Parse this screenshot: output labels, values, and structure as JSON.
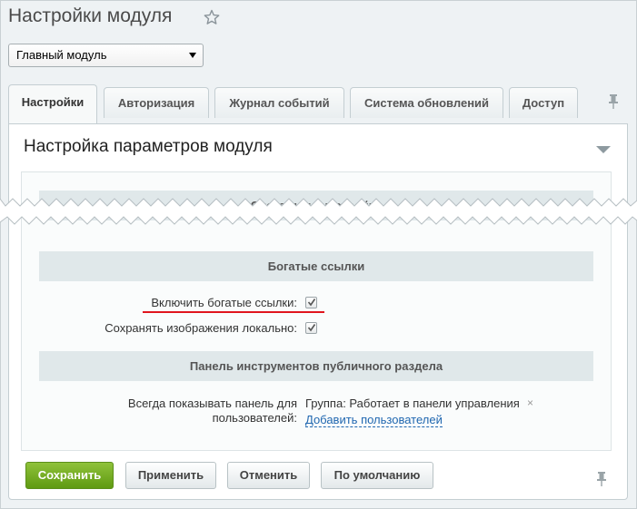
{
  "page": {
    "title": "Настройки модуля"
  },
  "module_select": {
    "value": "Главный модуль"
  },
  "tabs": [
    {
      "label": "Настройки",
      "active": true
    },
    {
      "label": "Авторизация"
    },
    {
      "label": "Журнал событий"
    },
    {
      "label": "Система обновлений"
    },
    {
      "label": "Доступ"
    }
  ],
  "panel": {
    "title": "Настройка параметров модуля",
    "section_partial": "Системные настройки",
    "sections": [
      {
        "title": "Богатые ссылки",
        "rows": [
          {
            "label": "Включить богатые ссылки:",
            "checked": true
          },
          {
            "label": "Сохранять изображения локально:",
            "checked": true
          }
        ]
      },
      {
        "title": "Панель инструментов публичного раздела",
        "rows": [
          {
            "label_line1": "Всегда показывать панель для",
            "label_line2": "пользователей:",
            "value": "Группа: Работает в панели управления",
            "remove_symbol": "×",
            "add_link": "Добавить пользователей"
          }
        ]
      }
    ]
  },
  "buttons": {
    "save": "Сохранить",
    "apply": "Применить",
    "cancel": "Отменить",
    "default": "По умолчанию"
  },
  "icons": {
    "favorite": "star-icon",
    "pin": "pin-icon",
    "collapse": "triangle-down-icon",
    "check": "check-icon"
  },
  "colors": {
    "primary_button": "#6ea81e",
    "link": "#2067b0",
    "highlight_line": "#e0151d"
  }
}
